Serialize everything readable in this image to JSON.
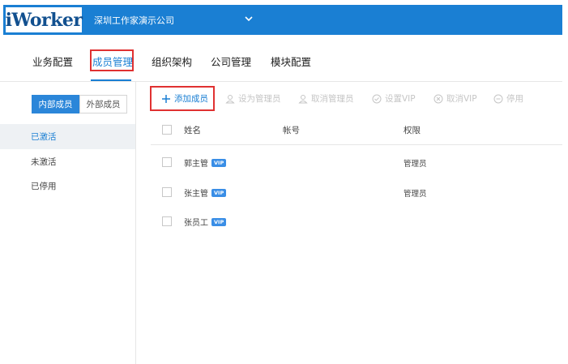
{
  "app": {
    "logo": "iWorker",
    "company": "深圳工作家演示公司"
  },
  "nav": {
    "items": [
      "业务配置",
      "成员管理",
      "组织架构",
      "公司管理",
      "模块配置"
    ],
    "active_index": 1
  },
  "sidebar": {
    "segments": [
      "内部成员",
      "外部成员"
    ],
    "active_segment": 0,
    "items": [
      "已激活",
      "未激活",
      "已停用"
    ],
    "active_item": 0
  },
  "toolbar": {
    "add_member": "添加成员",
    "set_admin": "设为管理员",
    "cancel_admin": "取消管理员",
    "set_vip": "设置VIP",
    "cancel_vip": "取消VIP",
    "disable": "停用"
  },
  "table": {
    "columns": [
      "姓名",
      "帐号",
      "权限"
    ],
    "rows": [
      {
        "name": "郭主管",
        "badge": "VIP",
        "account": "",
        "role": "管理员"
      },
      {
        "name": "张主管",
        "badge": "VIP",
        "account": "",
        "role": "管理员"
      },
      {
        "name": "张员工",
        "badge": "VIP",
        "account": "",
        "role": ""
      }
    ]
  },
  "colors": {
    "brand": "#1a7fd3",
    "highlight": "#e03131",
    "disabled": "#c5c5c5"
  }
}
